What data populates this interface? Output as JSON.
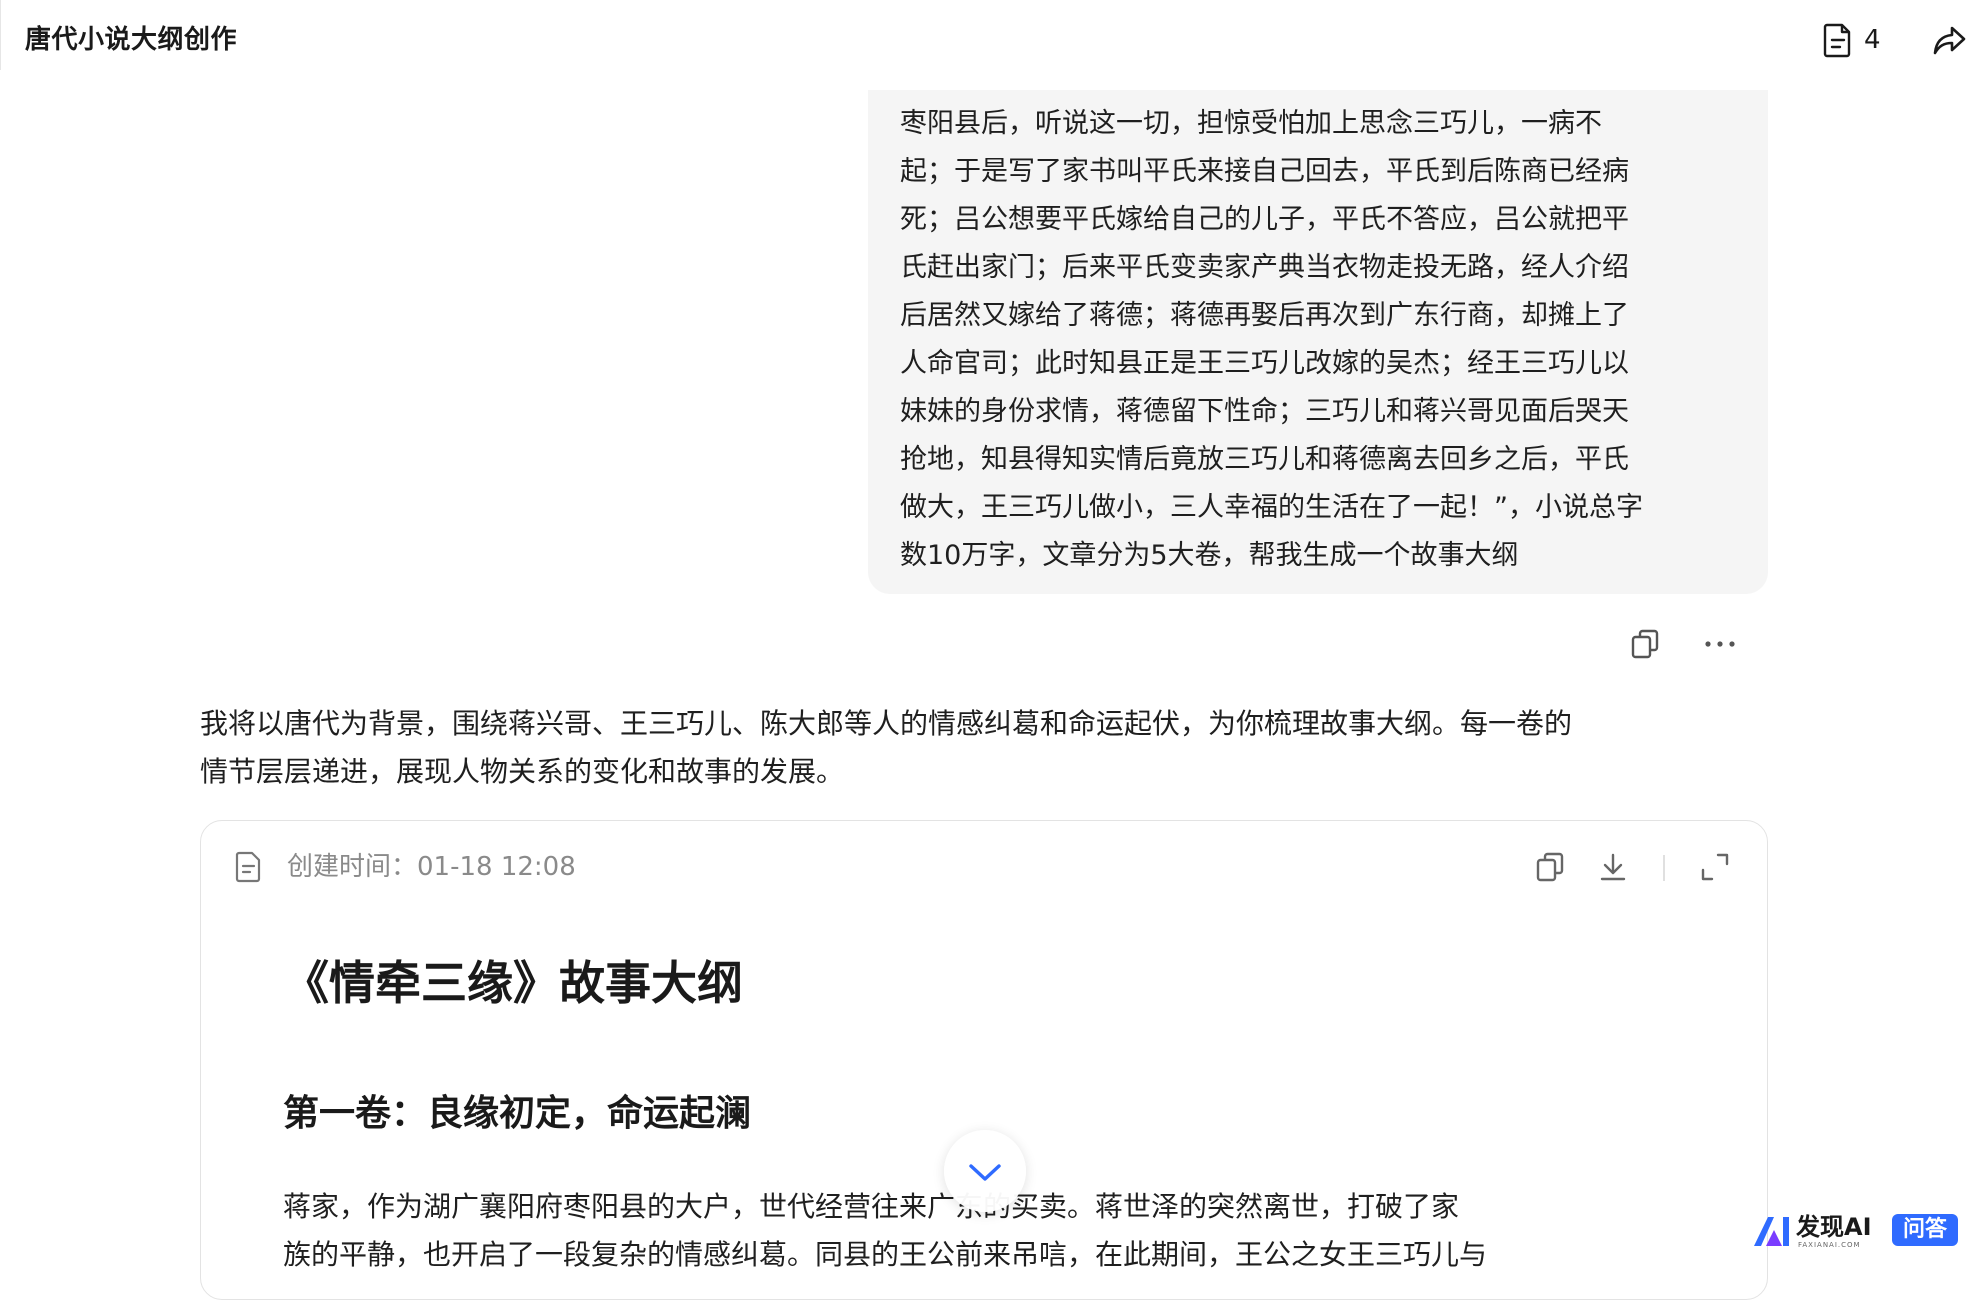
{
  "header": {
    "title": "唐代小说大纲创作",
    "doc_count": "4"
  },
  "user_message": {
    "text": "枣阳县后，听说这一切，担惊受怕加上思念三巧儿，一病不\n起；于是写了家书叫平氏来接自己回去，平氏到后陈商已经病\n死；吕公想要平氏嫁给自己的儿子，平氏不答应，吕公就把平\n氏赶出家门；后来平氏变卖家产典当衣物走投无路，经人介绍\n后居然又嫁给了蒋德；蒋德再娶后再次到广东行商，却摊上了\n人命官司；此时知县正是王三巧儿改嫁的吴杰；经王三巧儿以\n妹妹的身份求情，蒋德留下性命；三巧儿和蒋兴哥见面后哭天\n抢地，知县得知实情后竟放三巧儿和蒋德离去回乡之后，平氏\n做大，王三巧儿做小，三人幸福的生活在了一起！”，小说总字\n数10万字，文章分为5大卷，帮我生成一个故事大纲"
  },
  "assistant": {
    "intro": "我将以唐代为背景，围绕蒋兴哥、王三巧儿、陈大郎等人的情感纠葛和命运起伏，为你梳理故事大纲。每一卷的\n情节层层递进，展现人物关系的变化和故事的发展。",
    "document": {
      "created_label": "创建时间：01-18 12:08",
      "title": "《情牵三缘》故事大纲",
      "volume1_title": "第一卷：良缘初定，命运起澜",
      "volume1_text": "蒋家，作为湖广襄阳府枣阳县的大户，世代经营往来广东的买卖。蒋世泽的突然离世，打破了家\n族的平静，也开启了一段复杂的情感纠葛。同县的王公前来吊唁，在此期间，王公之女王三巧儿与"
    }
  },
  "watermark": {
    "text": "发现AI",
    "sub": "FAXIANAI.COM",
    "badge": "问答"
  },
  "colors": {
    "bubble_bg": "#f5f5f5",
    "meta_gray": "#8a8a8a",
    "badge_blue": "#2f6bff"
  }
}
